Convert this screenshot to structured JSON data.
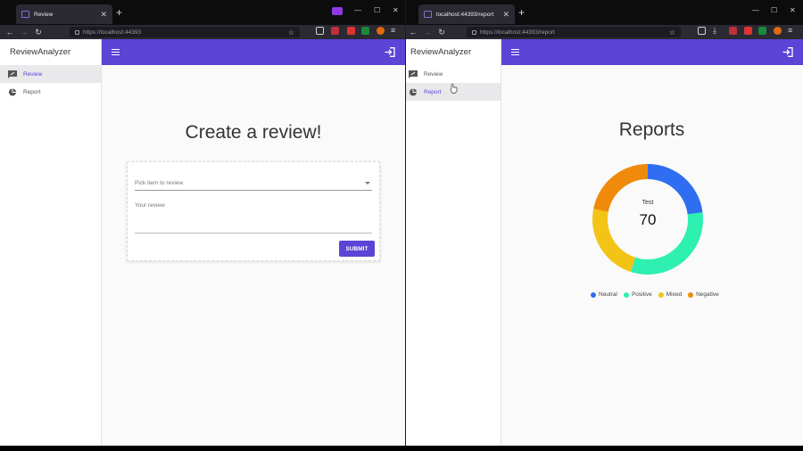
{
  "left_window": {
    "tab_title": "Review",
    "url": "https://localhost:44393",
    "brand": "ReviewAnalyzer",
    "nav": [
      {
        "label": "Review",
        "icon": "rate-review-icon"
      },
      {
        "label": "Report",
        "icon": "pie-chart-icon"
      }
    ],
    "heading": "Create a review!",
    "form": {
      "select_placeholder": "Pick item to review",
      "review_placeholder": "Your review",
      "submit_label": "SUBMIT"
    }
  },
  "right_window": {
    "tab_title": "localhost:44393/report",
    "url": "https://localhost:44393/report",
    "brand": "ReviewAnalyzer",
    "nav": [
      {
        "label": "Review",
        "icon": "rate-review-icon"
      },
      {
        "label": "Report",
        "icon": "pie-chart-icon"
      }
    ],
    "heading": "Reports"
  },
  "colors": {
    "accent": "#5b44d6",
    "neutral": "#2f6ef0",
    "positive": "#2ef0b0",
    "mixed": "#f3c316",
    "negative": "#f08a0b"
  },
  "chart_data": {
    "type": "pie",
    "variant": "doughnut",
    "center_label": "Test",
    "center_value": "70",
    "categories": [
      "Neutral",
      "Positive",
      "Mixed",
      "Negative"
    ],
    "values": [
      23,
      32,
      23,
      22
    ],
    "legend_position": "bottom"
  }
}
